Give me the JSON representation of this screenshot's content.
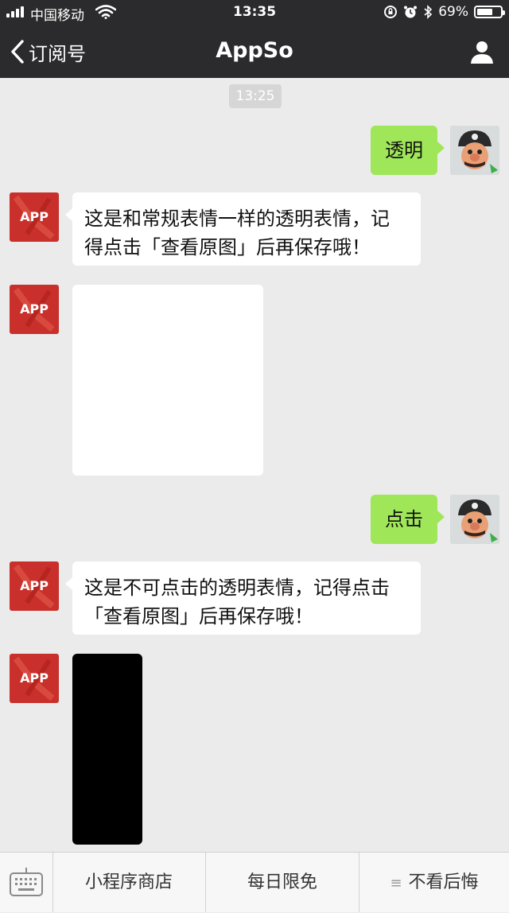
{
  "status_bar": {
    "carrier": "中国移动",
    "time": "13:35",
    "battery": "69%",
    "battery_level": 0.69
  },
  "nav": {
    "back_label": "订阅号",
    "title": "AppSo"
  },
  "chat": {
    "timestamp": "13:25",
    "app_avatar_text": "APP",
    "messages": [
      {
        "from": "user",
        "text": "透明"
      },
      {
        "from": "app",
        "lines": [
          "这是和常规表情一样的透明表情，记",
          "得点击「查看原图」后再保存哦！"
        ]
      },
      {
        "from": "app",
        "type": "image",
        "color": "#ffffff"
      },
      {
        "from": "user",
        "text": "点击"
      },
      {
        "from": "app",
        "lines": [
          "这是不可点击的透明表情，记得点击",
          "「查看原图」后再保存哦！"
        ]
      },
      {
        "from": "app",
        "type": "image",
        "color": "#000000"
      }
    ]
  },
  "bottom_menu": {
    "items": [
      "小程序商店",
      "每日限免",
      "不看后悔"
    ]
  },
  "colors": {
    "header_bg": "#2b2b2d",
    "chat_bg": "#ebebeb",
    "user_bubble": "#9fe658",
    "app_avatar": "#c9302c"
  }
}
